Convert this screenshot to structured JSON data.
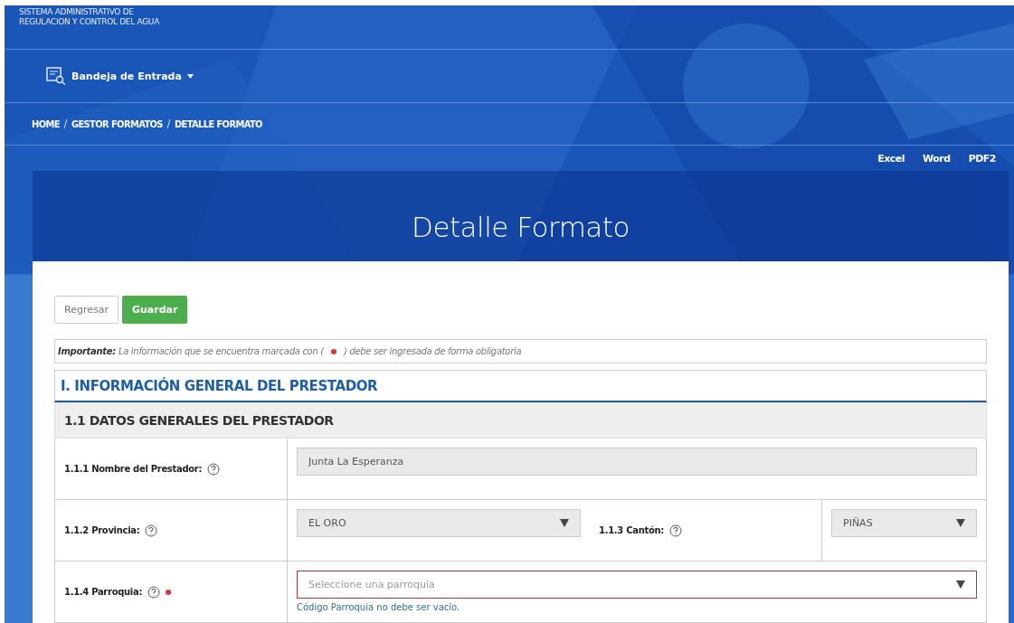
{
  "header": {
    "system_name_lines": [
      "SISTEMA ADMINISTRATIVO DE",
      "REGULACION Y CONTROL DEL AGUA"
    ]
  },
  "nav": {
    "menu_label": "Bandeja de Entrada",
    "expanded": false
  },
  "breadcrumb": [
    "HOME",
    "GESTOR FORMATOS",
    "DETALLE FORMATO"
  ],
  "export_links": [
    "Excel",
    "Word",
    "PDF2"
  ],
  "banner": {
    "title": "Detalle Formato"
  },
  "buttons": [
    {
      "label": "Regresar",
      "kind": "default"
    },
    {
      "label": "Guardar",
      "kind": "primary"
    }
  ],
  "notice": {
    "before": "**Importante:** La información que se encuentra marcada con (",
    "after": ") debe ser ingresada de forma obligatoria"
  },
  "section": {
    "title": "I. INFORMACIÓN GENERAL DEL PRESTADOR"
  },
  "subsection": {
    "title": "1.1 DATOS GENERALES DEL PRESTADOR"
  },
  "rows": [
    {
      "fields": [
        {
          "label": "1.1.1 Nombre del Prestador:",
          "required": false,
          "kind": "text",
          "value": "Junta La Esperanza",
          "invalid": false
        }
      ]
    },
    {
      "fields": [
        {
          "label": "1.1.2 Provincia:",
          "required": false,
          "kind": "select",
          "value": "EL ORO",
          "invalid": false
        },
        {
          "label": "1.1.3 Cantón:",
          "required": false,
          "kind": "select",
          "value": "PIÑAS",
          "invalid": false
        }
      ]
    },
    {
      "fields": [
        {
          "label": "1.1.4 Parroquia:",
          "required": true,
          "kind": "select",
          "placeholder": "Seleccione una parroquia",
          "invalid": true,
          "error": "Código Parroquia no debe ser vacío."
        }
      ]
    }
  ]
}
